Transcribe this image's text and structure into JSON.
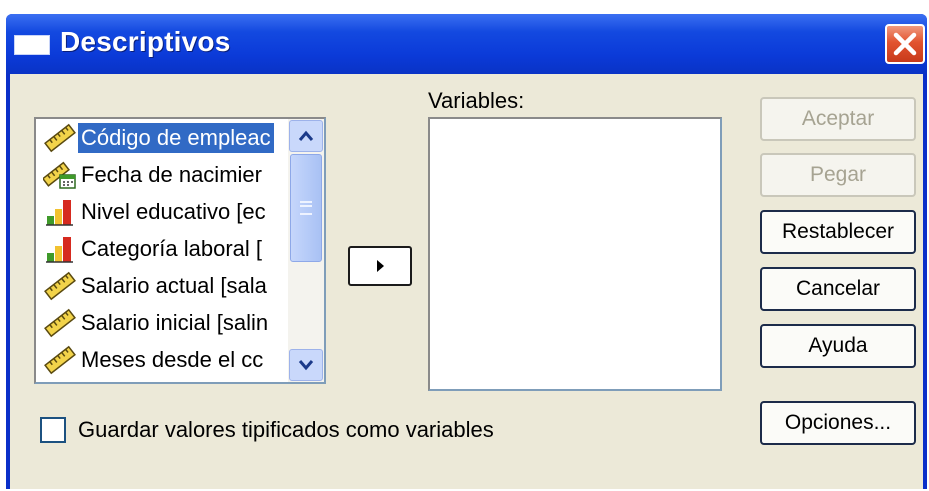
{
  "window": {
    "title": "Descriptivos",
    "close_icon": "close-icon"
  },
  "source_list": {
    "items": [
      {
        "label": "Código de empleac",
        "icon": "scale-ruler-icon",
        "selected": true
      },
      {
        "label": "Fecha de nacimier",
        "icon": "date-ruler-icon",
        "selected": false
      },
      {
        "label": "Nivel educativo [ec",
        "icon": "ordinal-bars-icon",
        "selected": false
      },
      {
        "label": "Categoría laboral [",
        "icon": "ordinal-bars-icon",
        "selected": false
      },
      {
        "label": "Salario actual [sala",
        "icon": "scale-ruler-icon",
        "selected": false
      },
      {
        "label": "Salario inicial [salin",
        "icon": "scale-ruler-icon",
        "selected": false
      },
      {
        "label": "Meses desde el cc",
        "icon": "scale-ruler-icon",
        "selected": false
      }
    ]
  },
  "variables": {
    "label": "Variables:"
  },
  "buttons": {
    "aceptar": "Aceptar",
    "pegar": "Pegar",
    "restablecer": "Restablecer",
    "cancelar": "Cancelar",
    "ayuda": "Ayuda",
    "opciones": "Opciones..."
  },
  "checkbox": {
    "label": "Guardar valores tipificados como variables",
    "checked": false
  },
  "colors": {
    "titlebar": "#0b3ad8",
    "selection": "#316ac5",
    "dialog_bg": "#ece9d8"
  }
}
